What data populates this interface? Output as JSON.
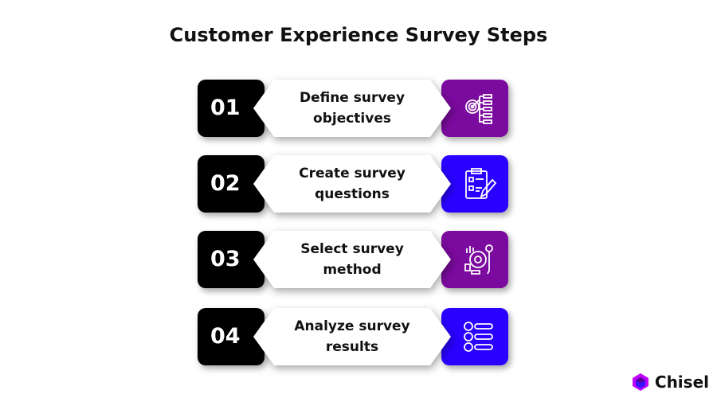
{
  "title": "Customer Experience Survey Steps",
  "steps": [
    {
      "number": "01",
      "label": "Define survey objectives",
      "icon": "target-flowchart-icon",
      "color": "#7b0a9e"
    },
    {
      "number": "02",
      "label": "Create survey questions",
      "icon": "clipboard-pencil-icon",
      "color": "#2a00ff"
    },
    {
      "number": "03",
      "label": "Select survey method",
      "icon": "analytics-gear-icon",
      "color": "#7b0a9e"
    },
    {
      "number": "04",
      "label": "Analyze survey results",
      "icon": "user-rating-list-icon",
      "color": "#2a00ff"
    }
  ],
  "brand": {
    "name": "Chisel",
    "colors": [
      "#c000ff",
      "#3a10ff"
    ]
  }
}
